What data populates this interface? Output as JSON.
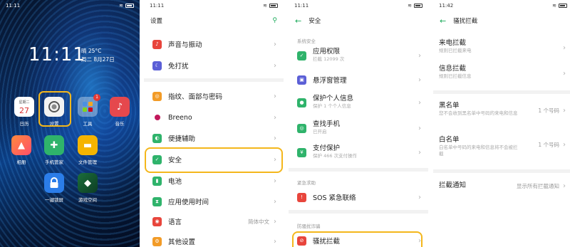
{
  "home": {
    "time": "11:11",
    "weather_line1": "晴 25°C",
    "weather_line2": "周二 8月27日",
    "calendar": {
      "weekday": "星期二",
      "day": "27"
    },
    "apps": [
      {
        "label": "日历"
      },
      {
        "label": "设置"
      },
      {
        "label": "工具",
        "badge": "1"
      },
      {
        "label": "音乐"
      },
      {
        "label": "相册"
      },
      {
        "label": "手机管家"
      },
      {
        "label": "文件管理"
      },
      {
        "label": "一键锁屏"
      },
      {
        "label": "游戏空间"
      }
    ],
    "status_time": "11:11"
  },
  "settings": {
    "status_time": "11:11",
    "title": "设置",
    "items": [
      {
        "label": "声音与振动",
        "color": "#e8453c"
      },
      {
        "label": "免打扰",
        "color": "#5b5fd6"
      },
      {
        "label": "指纹、面部与密码",
        "color": "#f29b27"
      },
      {
        "label": "Breeno",
        "color": "#c2185b"
      },
      {
        "label": "便捷辅助",
        "color": "#2fb36b"
      },
      {
        "label": "安全",
        "color": "#2fb36b"
      },
      {
        "label": "电池",
        "color": "#2fb36b"
      },
      {
        "label": "应用使用时间",
        "color": "#2fb36b"
      },
      {
        "label": "语言",
        "color": "#e8453c",
        "value": "简体中文"
      },
      {
        "label": "其他设置",
        "color": "#f29b27"
      }
    ]
  },
  "security": {
    "status_time": "11:11",
    "title": "安全",
    "section1": "系统安全",
    "items": [
      {
        "label": "应用权限",
        "sub": "拦截 12099 次"
      },
      {
        "label": "悬浮窗管理",
        "sub": ""
      },
      {
        "label": "保护个人信息",
        "sub": "保护 1 个个人信息"
      },
      {
        "label": "查找手机",
        "sub": "已开启"
      },
      {
        "label": "支付保护",
        "sub": "保护 466 次支付操作"
      }
    ],
    "section2": "紧急求助",
    "sos": "SOS 紧急联络",
    "section3": "防骚扰诈骗",
    "block": "骚扰拦截"
  },
  "block": {
    "status_time": "11:42",
    "title": "骚扰拦截",
    "call_title": "来电拦截",
    "call_sub": "规则已拦截来电",
    "msg_title": "信息拦截",
    "msg_sub": "规则已拦截信息",
    "black_title": "黑名单",
    "black_sub": "您不会收到黑名单中号码的来电和信息",
    "black_val": "1 个号码",
    "white_title": "白名单",
    "white_sub": "白名单中号码的来电和信息将不会被拦截",
    "white_val": "1 个号码",
    "notify_title": "拦截通知",
    "notify_val": "显示所有拦截通知"
  },
  "colors": {
    "accent": "#1aaa5a",
    "highlight": "#f4b71c"
  }
}
